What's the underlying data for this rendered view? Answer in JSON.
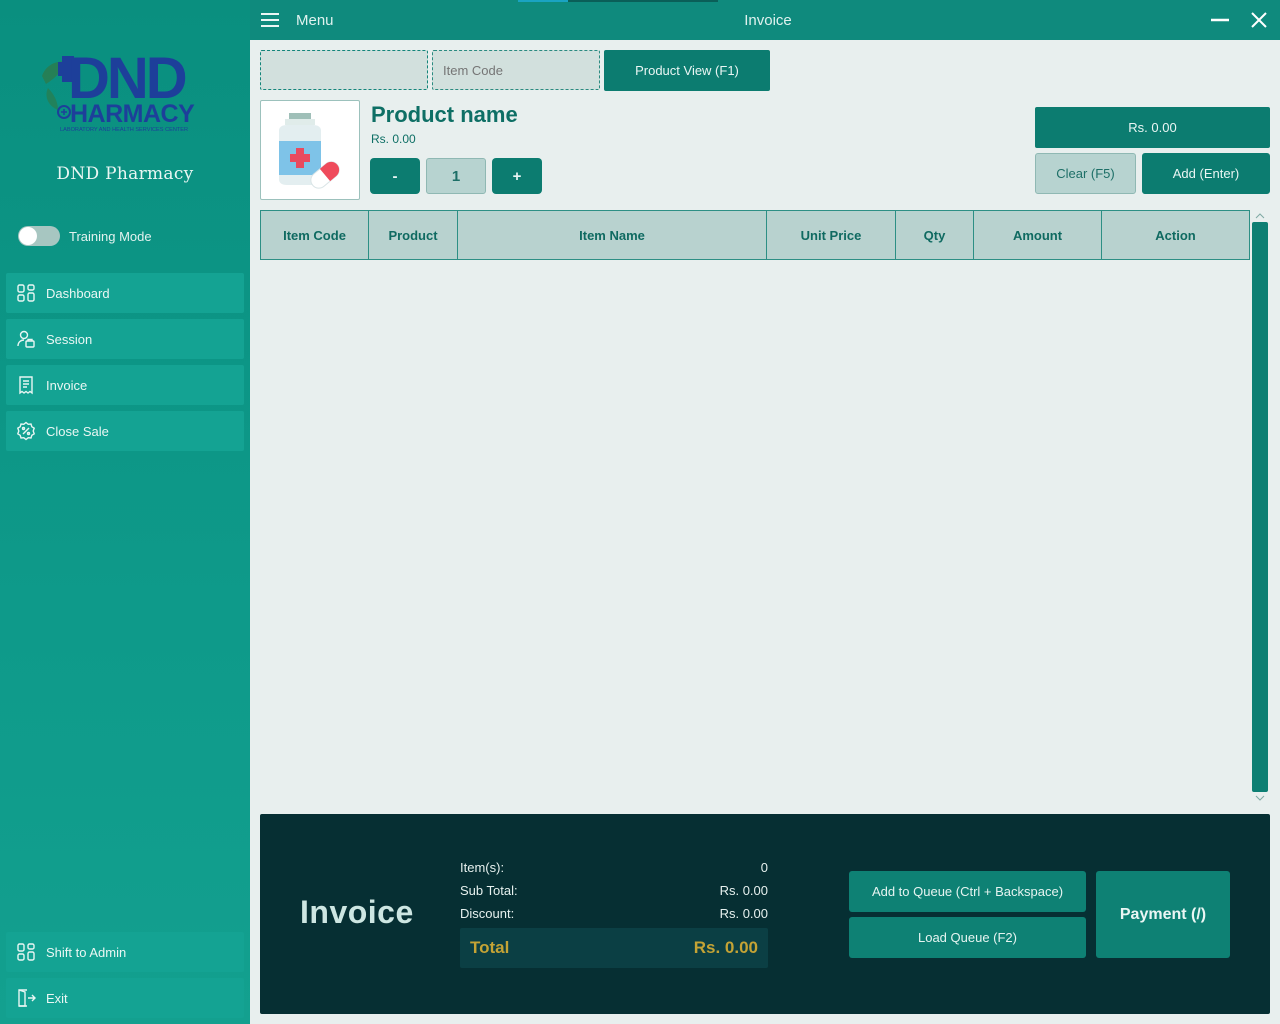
{
  "app": {
    "brand_name": "DND Pharmacy",
    "logo_text_main": "DND",
    "logo_text_sub": "HARMACY",
    "logo_tagline": "LABORATORY AND HEALTH SERVICES CENTER"
  },
  "topbar": {
    "menu_label": "Menu",
    "title": "Invoice"
  },
  "sidebar": {
    "training_mode": {
      "label": "Training Mode",
      "enabled": false
    },
    "items": [
      {
        "label": "Dashboard",
        "icon": "dashboard-grid-icon"
      },
      {
        "label": "Session",
        "icon": "user-session-icon"
      },
      {
        "label": "Invoice",
        "icon": "receipt-icon"
      },
      {
        "label": "Close Sale",
        "icon": "discount-badge-icon"
      }
    ],
    "bottom_items": [
      {
        "label": "Shift to Admin",
        "icon": "dashboard-grid-icon"
      },
      {
        "label": "Exit",
        "icon": "exit-door-icon"
      }
    ]
  },
  "search": {
    "barcode_value": "",
    "item_code_placeholder": "Item Code",
    "product_view_label": "Product View (F1)"
  },
  "product": {
    "name": "Product name",
    "price": "Rs. 0.00",
    "qty": "1",
    "minus_label": "-",
    "plus_label": "+",
    "line_total": "Rs. 0.00",
    "clear_label": "Clear (F5)",
    "add_label": "Add (Enter)"
  },
  "table": {
    "columns": [
      "Item Code",
      "Product",
      "Item Name",
      "Unit Price",
      "Qty",
      "Amount",
      "Action"
    ],
    "rows": []
  },
  "summary": {
    "heading": "Invoice",
    "items_label": "Item(s):",
    "items_value": "0",
    "subtotal_label": "Sub Total:",
    "subtotal_value": "Rs. 0.00",
    "discount_label": "Discount:",
    "discount_value": "Rs. 0.00",
    "total_label": "Total",
    "total_value": "Rs. 0.00",
    "add_queue_label": "Add to Queue (Ctrl + Backspace)",
    "load_queue_label": "Load Queue (F2)",
    "payment_label": "Payment (/)"
  },
  "colors": {
    "sidebar": "#0a8f7f",
    "topbar": "#0f8a7d",
    "footer": "#062f33",
    "total_accent": "#c4a335"
  }
}
